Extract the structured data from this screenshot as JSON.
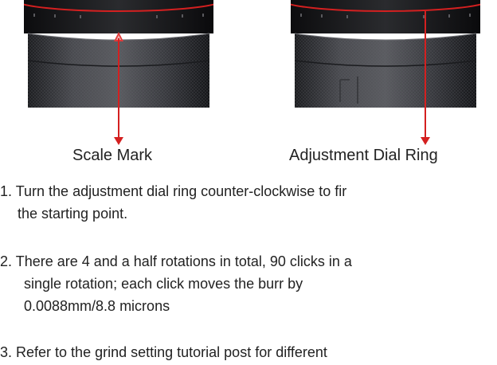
{
  "labels": {
    "scale_mark": "Scale Mark",
    "adjustment_dial_ring": "Adjustment Dial Ring"
  },
  "steps": [
    {
      "number": "1.",
      "lines": [
        "Turn the adjustment dial ring counter-clockwise to fir",
        "the starting point."
      ]
    },
    {
      "number": "2.",
      "lines": [
        "There are 4 and a half rotations in total, 90 clicks in a",
        "single rotation; each click moves the burr by",
        "0.0088mm/8.8 microns"
      ]
    },
    {
      "number": "3.",
      "lines": [
        "Refer to the grind setting tutorial post for different"
      ]
    }
  ],
  "colors": {
    "annotation_red": "#d42020",
    "grinder_body": "#2c2d30"
  }
}
